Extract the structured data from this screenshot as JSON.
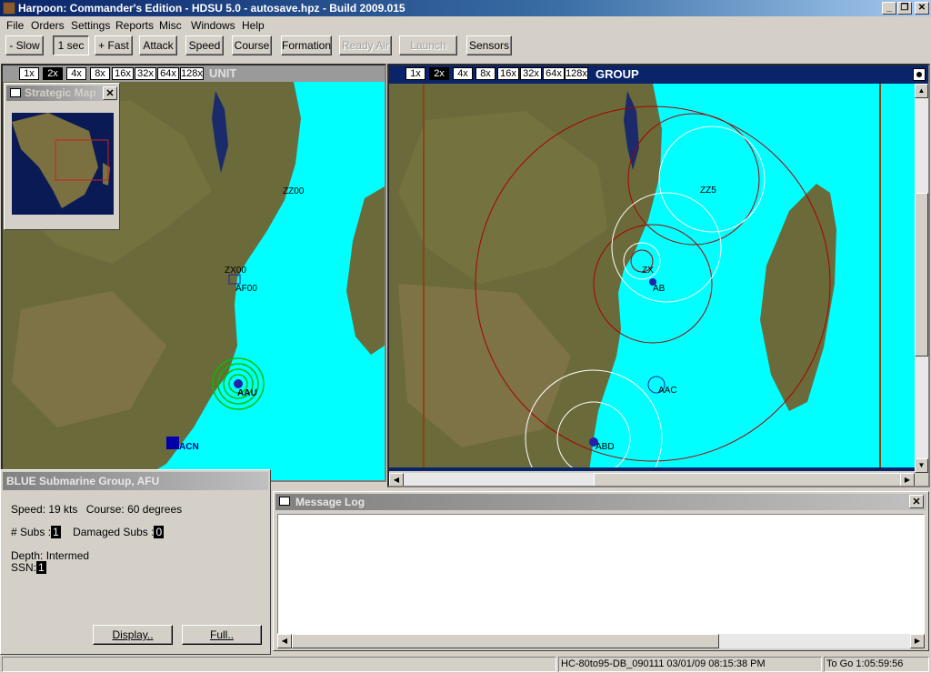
{
  "window": {
    "title": "Harpoon: Commander's Edition - HDSU 5.0 - autosave.hpz - Build 2009.015",
    "minimize": "_",
    "maximize": "❐",
    "close": "✕"
  },
  "menu": [
    "File",
    "Orders",
    "Settings",
    "Reports",
    "Misc",
    "Windows",
    "Help"
  ],
  "toolbar": {
    "slow": "- Slow",
    "time": "1 sec",
    "fast": "+ Fast",
    "attack": "Attack",
    "speed": "Speed",
    "course": "Course",
    "formation": "Formation",
    "ready_air": "Ready Air",
    "launch": "Launch",
    "sensors": "Sensors"
  },
  "zoom_levels": [
    "1x",
    "2x",
    "4x",
    "8x",
    "16x",
    "32x",
    "64x",
    "128x"
  ],
  "unit_map": {
    "title": "UNIT",
    "selected_zoom": "2x",
    "labels": {
      "zz00": "ZZ00",
      "zx00": "ZX00",
      "af00": "AF00",
      "afu": "AAU",
      "acn": "ACN"
    }
  },
  "group_map": {
    "title": "GROUP",
    "selected_zoom": "2x",
    "labels": {
      "zz": "ZZ5",
      "zx": "ZX",
      "ab": "AB",
      "aac": "AAC",
      "abd": "ABD"
    }
  },
  "strategic_map": {
    "title": "Strategic Map",
    "close": "✕"
  },
  "unit_panel": {
    "title": "BLUE Submarine Group, AFU",
    "speed": "Speed: 19 kts",
    "course": "Course: 60 degrees",
    "subs_label": "# Subs :",
    "subs_value": "1",
    "damaged_label": "Damaged Subs :",
    "damaged_value": "0",
    "depth": "Depth: Intermed",
    "ssn_label": "SSN:",
    "ssn_value": "1",
    "display_btn": "Display..",
    "full_btn": "Full.."
  },
  "message_log": {
    "title": "Message Log",
    "close": "✕"
  },
  "status": {
    "scenario": "HC-80to95-DB_090111 03/01/09 08:15:38 PM",
    "to_go": "To Go 1:05:59:56"
  }
}
